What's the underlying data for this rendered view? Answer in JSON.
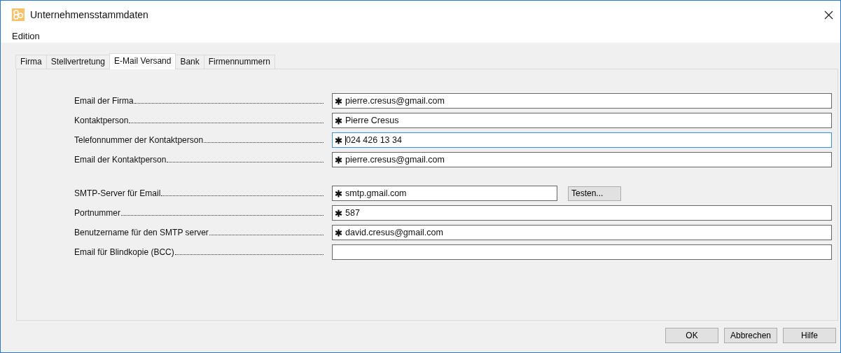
{
  "window": {
    "title": "Unternehmensstammdaten"
  },
  "menu": [
    "Edition"
  ],
  "tabs": [
    {
      "label": "Firma",
      "selected": false
    },
    {
      "label": "Stellvertretung",
      "selected": false
    },
    {
      "label": "E-Mail Versand",
      "selected": true
    },
    {
      "label": "Bank",
      "selected": false
    },
    {
      "label": "Firmennummern",
      "selected": false
    }
  ],
  "groups": [
    [
      {
        "label": "Email der Firma",
        "value": "pierre.cresus@gmail.com",
        "required": true,
        "focused": false
      },
      {
        "label": "Kontaktperson",
        "value": "Pierre Cresus",
        "required": true,
        "focused": false
      },
      {
        "label": "Telefonnummer der Kontaktperson",
        "value": "024 426 13 34",
        "required": true,
        "focused": true
      },
      {
        "label": "Email der Kontaktperson",
        "value": "pierre.cresus@gmail.com",
        "required": true,
        "focused": false
      }
    ],
    [
      {
        "label": "SMTP-Server für Email",
        "value": "smtp.gmail.com",
        "required": true,
        "focused": false,
        "button": "Testen..."
      },
      {
        "label": "Portnummer",
        "value": "587",
        "required": true,
        "focused": false
      },
      {
        "label": "Benutzername für den SMTP server",
        "value": "david.cresus@gmail.com",
        "required": true,
        "focused": false
      },
      {
        "label": "Email für Blindkopie (BCC)",
        "required": false,
        "focused": false
      }
    ]
  ],
  "buttons": [
    "OK",
    "Abbrechen",
    "Hilfe"
  ]
}
